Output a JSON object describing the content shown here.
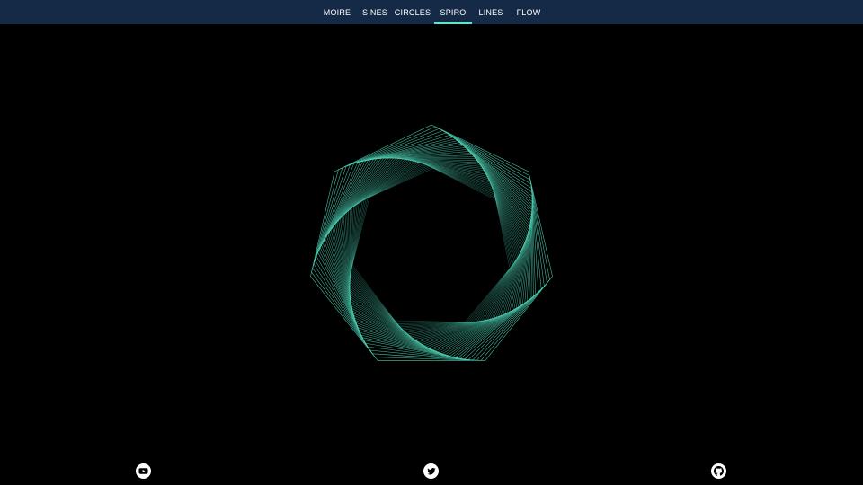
{
  "nav": {
    "tabs": [
      {
        "label": "MOIRE"
      },
      {
        "label": "SINES"
      },
      {
        "label": "CIRCLES"
      },
      {
        "label": "SPIRO",
        "active": true
      },
      {
        "label": "LINES"
      },
      {
        "label": "FLOW"
      }
    ],
    "active_tab": "SPIRO"
  },
  "colors": {
    "nav_background": "#142a47",
    "active_underline": "#5ee6cb",
    "stroke": "#4fd6b8",
    "background": "#000000"
  },
  "footer": {
    "icons": [
      {
        "name": "youtube-icon"
      },
      {
        "name": "twitter-icon"
      },
      {
        "name": "github-icon"
      }
    ]
  }
}
